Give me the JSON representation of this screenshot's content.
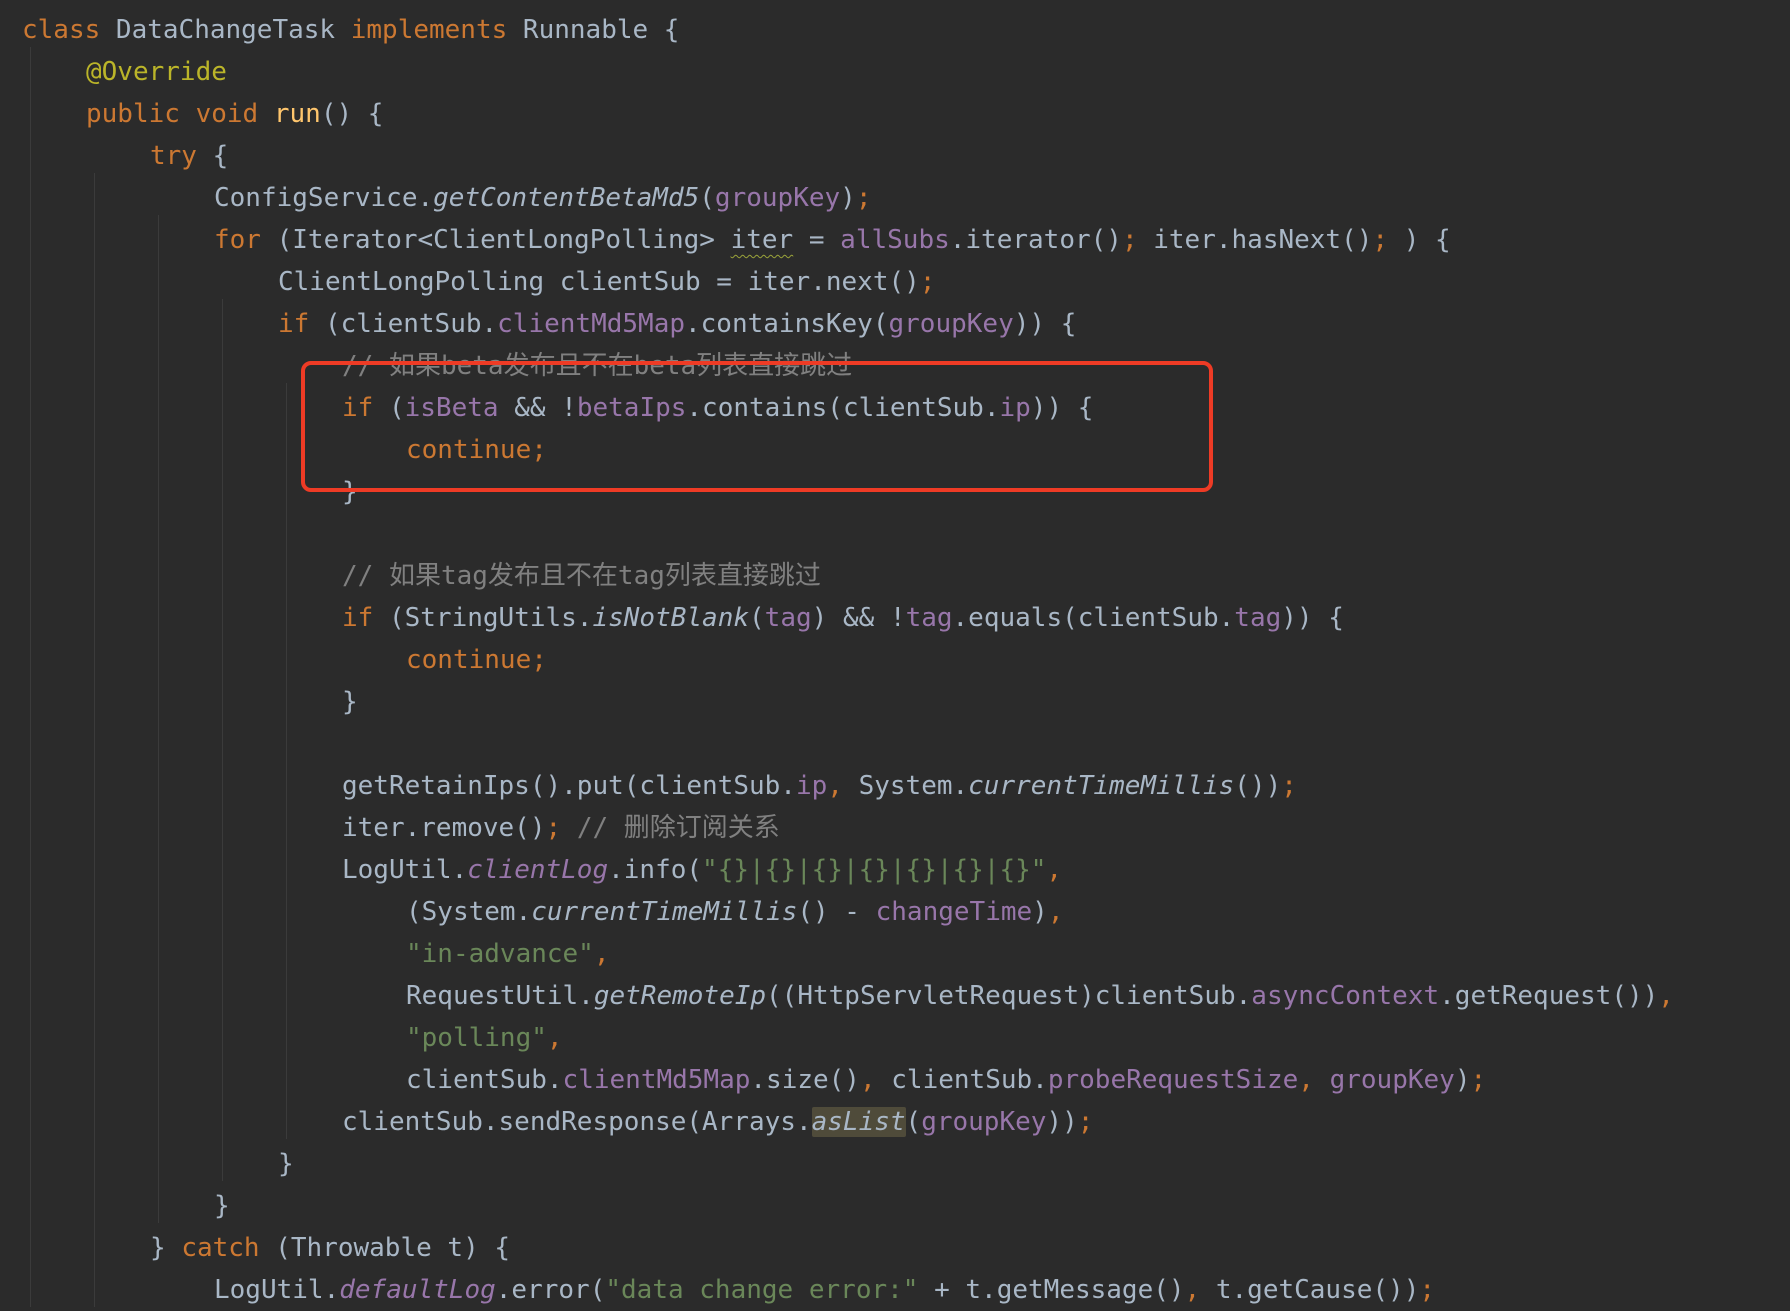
{
  "editor": {
    "language": "java",
    "font": "monospace",
    "colors": {
      "background": "#2b2b2b",
      "keyword": "#cc7832",
      "plain": "#a9b7c6",
      "annotation": "#bbb529",
      "method": "#ffc66d",
      "field": "#9876aa",
      "string": "#6a8759",
      "comment": "#808080",
      "callout": "#ee3b25"
    },
    "lines": [
      {
        "indent": 0,
        "tokens": [
          {
            "t": "class ",
            "c": "keyword"
          },
          {
            "t": "DataChangeTask ",
            "c": "plain"
          },
          {
            "t": "implements ",
            "c": "keyword"
          },
          {
            "t": "Runnable {",
            "c": "plain"
          }
        ]
      },
      {
        "indent": 1,
        "tokens": [
          {
            "t": "@Override",
            "c": "annotation"
          }
        ]
      },
      {
        "indent": 1,
        "tokens": [
          {
            "t": "public ",
            "c": "keyword"
          },
          {
            "t": "void ",
            "c": "keyword"
          },
          {
            "t": "run",
            "c": "method"
          },
          {
            "t": "() {",
            "c": "plain"
          }
        ]
      },
      {
        "indent": 2,
        "tokens": [
          {
            "t": "try ",
            "c": "keyword"
          },
          {
            "t": "{",
            "c": "plain"
          }
        ]
      },
      {
        "indent": 3,
        "tokens": [
          {
            "t": "ConfigService.",
            "c": "plain"
          },
          {
            "t": "getContentBetaMd5",
            "c": "static-call"
          },
          {
            "t": "(",
            "c": "plain"
          },
          {
            "t": "groupKey",
            "c": "field"
          },
          {
            "t": ")",
            "c": "plain"
          },
          {
            "t": ";",
            "c": "punct"
          }
        ]
      },
      {
        "indent": 3,
        "tokens": [
          {
            "t": "for ",
            "c": "keyword"
          },
          {
            "t": "(Iterator<ClientLongPolling> ",
            "c": "plain"
          },
          {
            "t": "iter",
            "c": "plain",
            "warn": true
          },
          {
            "t": " = ",
            "c": "plain"
          },
          {
            "t": "allSubs",
            "c": "field"
          },
          {
            "t": ".iterator()",
            "c": "plain"
          },
          {
            "t": "; ",
            "c": "punct"
          },
          {
            "t": "iter.hasNext()",
            "c": "plain"
          },
          {
            "t": "; ",
            "c": "punct"
          },
          {
            "t": ") {",
            "c": "plain"
          }
        ]
      },
      {
        "indent": 4,
        "tokens": [
          {
            "t": "ClientLongPolling clientSub = iter.next()",
            "c": "plain"
          },
          {
            "t": ";",
            "c": "punct"
          }
        ]
      },
      {
        "indent": 4,
        "tokens": [
          {
            "t": "if ",
            "c": "keyword"
          },
          {
            "t": "(clientSub.",
            "c": "plain"
          },
          {
            "t": "clientMd5Map",
            "c": "field"
          },
          {
            "t": ".containsKey(",
            "c": "plain"
          },
          {
            "t": "groupKey",
            "c": "field"
          },
          {
            "t": ")) {",
            "c": "plain"
          }
        ]
      },
      {
        "indent": 5,
        "tokens": [
          {
            "t": "// 如果beta发布且不在beta列表直接跳过",
            "c": "comment"
          }
        ]
      },
      {
        "indent": 5,
        "tokens": [
          {
            "t": "if ",
            "c": "keyword"
          },
          {
            "t": "(",
            "c": "plain"
          },
          {
            "t": "isBeta",
            "c": "field"
          },
          {
            "t": " && !",
            "c": "plain"
          },
          {
            "t": "betaIps",
            "c": "field"
          },
          {
            "t": ".contains(clientSub.",
            "c": "plain"
          },
          {
            "t": "ip",
            "c": "field"
          },
          {
            "t": ")) {",
            "c": "plain"
          }
        ]
      },
      {
        "indent": 6,
        "tokens": [
          {
            "t": "continue",
            "c": "keyword"
          },
          {
            "t": ";",
            "c": "punct"
          }
        ]
      },
      {
        "indent": 5,
        "tokens": [
          {
            "t": "}",
            "c": "plain"
          }
        ]
      },
      {
        "indent": 0,
        "tokens": []
      },
      {
        "indent": 5,
        "tokens": [
          {
            "t": "// 如果tag发布且不在tag列表直接跳过",
            "c": "comment"
          }
        ]
      },
      {
        "indent": 5,
        "tokens": [
          {
            "t": "if ",
            "c": "keyword"
          },
          {
            "t": "(StringUtils.",
            "c": "plain"
          },
          {
            "t": "isNotBlank",
            "c": "static-call"
          },
          {
            "t": "(",
            "c": "plain"
          },
          {
            "t": "tag",
            "c": "field"
          },
          {
            "t": ") && !",
            "c": "plain"
          },
          {
            "t": "tag",
            "c": "field"
          },
          {
            "t": ".equals(clientSub.",
            "c": "plain"
          },
          {
            "t": "tag",
            "c": "field"
          },
          {
            "t": ")) {",
            "c": "plain"
          }
        ]
      },
      {
        "indent": 6,
        "tokens": [
          {
            "t": "continue",
            "c": "keyword"
          },
          {
            "t": ";",
            "c": "punct"
          }
        ]
      },
      {
        "indent": 5,
        "tokens": [
          {
            "t": "}",
            "c": "plain"
          }
        ]
      },
      {
        "indent": 0,
        "tokens": []
      },
      {
        "indent": 5,
        "tokens": [
          {
            "t": "getRetainIps().put(clientSub.",
            "c": "plain"
          },
          {
            "t": "ip",
            "c": "field"
          },
          {
            "t": ", ",
            "c": "punct"
          },
          {
            "t": "System.",
            "c": "plain"
          },
          {
            "t": "currentTimeMillis",
            "c": "static-call"
          },
          {
            "t": "())",
            "c": "plain"
          },
          {
            "t": ";",
            "c": "punct"
          }
        ]
      },
      {
        "indent": 5,
        "tokens": [
          {
            "t": "iter.remove()",
            "c": "plain"
          },
          {
            "t": "; ",
            "c": "punct"
          },
          {
            "t": "// 删除订阅关系",
            "c": "comment"
          }
        ]
      },
      {
        "indent": 5,
        "tokens": [
          {
            "t": "LogUtil.",
            "c": "plain"
          },
          {
            "t": "clientLog",
            "c": "italic-field"
          },
          {
            "t": ".info(",
            "c": "plain"
          },
          {
            "t": "\"{}|{}|{}|{}|{}|{}|{}\"",
            "c": "string"
          },
          {
            "t": ",",
            "c": "punct"
          }
        ]
      },
      {
        "indent": 6,
        "tokens": [
          {
            "t": "(System.",
            "c": "plain"
          },
          {
            "t": "currentTimeMillis",
            "c": "static-call"
          },
          {
            "t": "() - ",
            "c": "plain"
          },
          {
            "t": "changeTime",
            "c": "field"
          },
          {
            "t": ")",
            "c": "plain"
          },
          {
            "t": ",",
            "c": "punct"
          }
        ]
      },
      {
        "indent": 6,
        "tokens": [
          {
            "t": "\"in-advance\"",
            "c": "string"
          },
          {
            "t": ",",
            "c": "punct"
          }
        ]
      },
      {
        "indent": 6,
        "tokens": [
          {
            "t": "RequestUtil.",
            "c": "plain"
          },
          {
            "t": "getRemoteIp",
            "c": "static-call"
          },
          {
            "t": "((HttpServletRequest)clientSub.",
            "c": "plain"
          },
          {
            "t": "asyncContext",
            "c": "field"
          },
          {
            "t": ".getRequest())",
            "c": "plain"
          },
          {
            "t": ",",
            "c": "punct"
          }
        ]
      },
      {
        "indent": 6,
        "tokens": [
          {
            "t": "\"polling\"",
            "c": "string"
          },
          {
            "t": ",",
            "c": "punct"
          }
        ]
      },
      {
        "indent": 6,
        "tokens": [
          {
            "t": "clientSub.",
            "c": "plain"
          },
          {
            "t": "clientMd5Map",
            "c": "field"
          },
          {
            "t": ".size()",
            "c": "plain"
          },
          {
            "t": ", ",
            "c": "punct"
          },
          {
            "t": "clientSub.",
            "c": "plain"
          },
          {
            "t": "probeRequestSize",
            "c": "field"
          },
          {
            "t": ", ",
            "c": "punct"
          },
          {
            "t": "groupKey",
            "c": "field"
          },
          {
            "t": ")",
            "c": "plain"
          },
          {
            "t": ";",
            "c": "punct"
          }
        ]
      },
      {
        "indent": 5,
        "tokens": [
          {
            "t": "clientSub.sendResponse(Arrays.",
            "c": "plain"
          },
          {
            "t": "asList",
            "c": "static-call",
            "highlight": true
          },
          {
            "t": "(",
            "c": "plain"
          },
          {
            "t": "groupKey",
            "c": "field"
          },
          {
            "t": "))",
            "c": "plain"
          },
          {
            "t": ";",
            "c": "punct"
          }
        ]
      },
      {
        "indent": 4,
        "tokens": [
          {
            "t": "}",
            "c": "plain"
          }
        ]
      },
      {
        "indent": 3,
        "tokens": [
          {
            "t": "}",
            "c": "plain"
          }
        ]
      },
      {
        "indent": 2,
        "tokens": [
          {
            "t": "} ",
            "c": "plain"
          },
          {
            "t": "catch ",
            "c": "keyword"
          },
          {
            "t": "(Throwable t) {",
            "c": "plain"
          }
        ]
      },
      {
        "indent": 3,
        "tokens": [
          {
            "t": "LogUtil.",
            "c": "plain"
          },
          {
            "t": "defaultLog",
            "c": "italic-field"
          },
          {
            "t": ".error(",
            "c": "plain"
          },
          {
            "t": "\"data change error:\"",
            "c": "string"
          },
          {
            "t": " + t.getMessage()",
            "c": "plain"
          },
          {
            "t": ", ",
            "c": "punct"
          },
          {
            "t": "t.getCause())",
            "c": "plain"
          },
          {
            "t": ";",
            "c": "punct"
          }
        ]
      }
    ]
  }
}
